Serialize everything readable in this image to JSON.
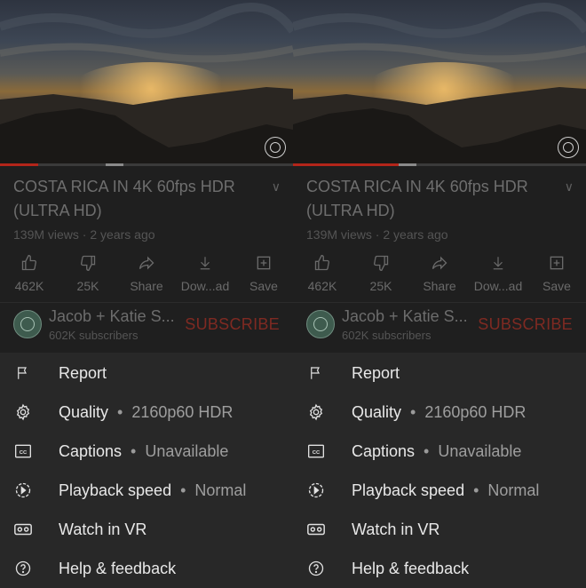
{
  "panels": [
    {
      "video": {
        "progress_played": 0.13,
        "buffer_start": 0.36,
        "buffer_end": 0.42,
        "badge_icon": "vr-360-badge-icon"
      },
      "title": "COSTA RICA IN 4K 60fps HDR (ULTRA HD)",
      "meta": "139M views · 2 years ago",
      "actions": [
        {
          "icon": "thumbs-up-icon",
          "label": "462K"
        },
        {
          "icon": "thumbs-down-icon",
          "label": "25K"
        },
        {
          "icon": "share-icon",
          "label": "Share"
        },
        {
          "icon": "download-icon",
          "label": "Dow...ad"
        },
        {
          "icon": "save-icon",
          "label": "Save"
        }
      ],
      "channel": {
        "name": "Jacob + Katie S...",
        "subs": "602K subscribers",
        "subscribe": "SUBSCRIBE"
      },
      "menu": [
        {
          "icon": "flag-icon",
          "label": "Report",
          "value": ""
        },
        {
          "icon": "gear-icon",
          "label": "Quality",
          "value": "2160p60 HDR"
        },
        {
          "icon": "cc-icon",
          "label": "Captions",
          "value": "Unavailable"
        },
        {
          "icon": "playback-speed-icon",
          "label": "Playback speed",
          "value": "Normal"
        },
        {
          "icon": "vr-headset-icon",
          "label": "Watch in VR",
          "value": ""
        },
        {
          "icon": "help-icon",
          "label": "Help & feedback",
          "value": ""
        }
      ]
    },
    {
      "video": {
        "progress_played": 0.36,
        "buffer_start": 0.36,
        "buffer_end": 0.42,
        "badge_icon": "vr-360-badge-icon"
      },
      "title": "COSTA RICA IN 4K 60fps HDR (ULTRA HD)",
      "meta": "139M views · 2 years ago",
      "actions": [
        {
          "icon": "thumbs-up-icon",
          "label": "462K"
        },
        {
          "icon": "thumbs-down-icon",
          "label": "25K"
        },
        {
          "icon": "share-icon",
          "label": "Share"
        },
        {
          "icon": "download-icon",
          "label": "Dow...ad"
        },
        {
          "icon": "save-icon",
          "label": "Save"
        }
      ],
      "channel": {
        "name": "Jacob + Katie S...",
        "subs": "602K subscribers",
        "subscribe": "SUBSCRIBE"
      },
      "menu": [
        {
          "icon": "flag-icon",
          "label": "Report",
          "value": ""
        },
        {
          "icon": "gear-icon",
          "label": "Quality",
          "value": "2160p60 HDR"
        },
        {
          "icon": "cc-icon",
          "label": "Captions",
          "value": "Unavailable"
        },
        {
          "icon": "playback-speed-icon",
          "label": "Playback speed",
          "value": "Normal"
        },
        {
          "icon": "vr-headset-icon",
          "label": "Watch in VR",
          "value": ""
        },
        {
          "icon": "help-icon",
          "label": "Help & feedback",
          "value": ""
        }
      ]
    }
  ]
}
